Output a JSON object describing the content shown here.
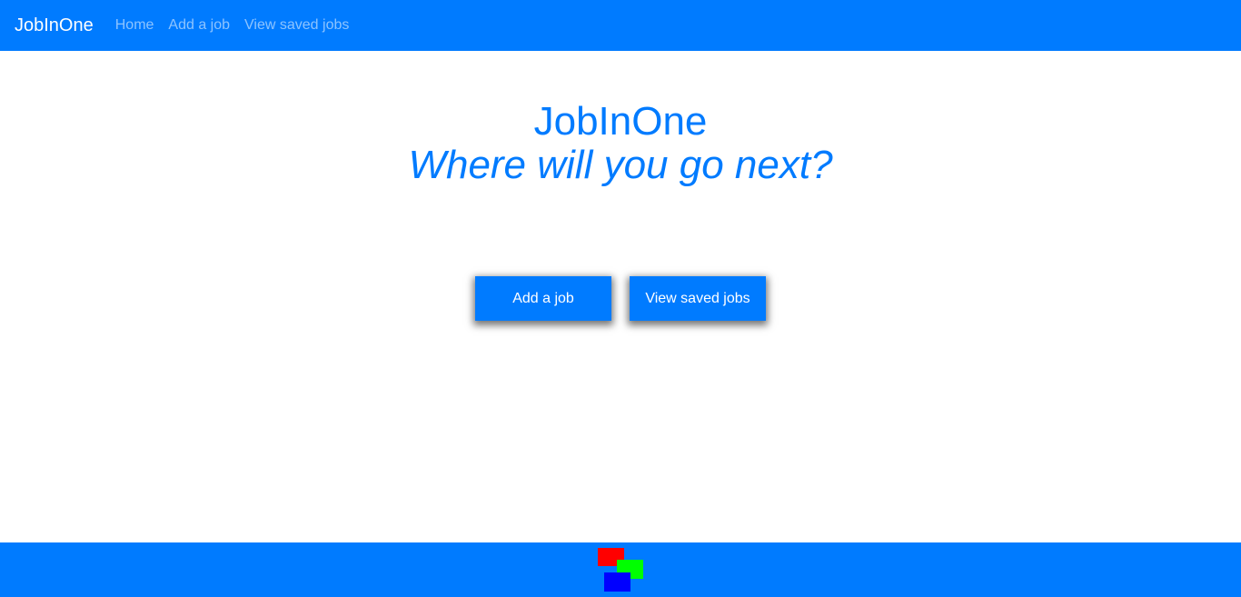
{
  "navbar": {
    "brand": "JobInOne",
    "links": [
      {
        "label": "Home"
      },
      {
        "label": "Add a job"
      },
      {
        "label": "View saved jobs"
      }
    ]
  },
  "hero": {
    "title": "JobInOne",
    "subtitle": "Where will you go next?"
  },
  "actions": {
    "add_job_label": "Add a job",
    "view_saved_label": "View saved jobs"
  },
  "footer": {
    "logo_colors": [
      "#ff0000",
      "#00ff00",
      "#0000ff"
    ]
  },
  "colors": {
    "accent": "#007bff"
  }
}
